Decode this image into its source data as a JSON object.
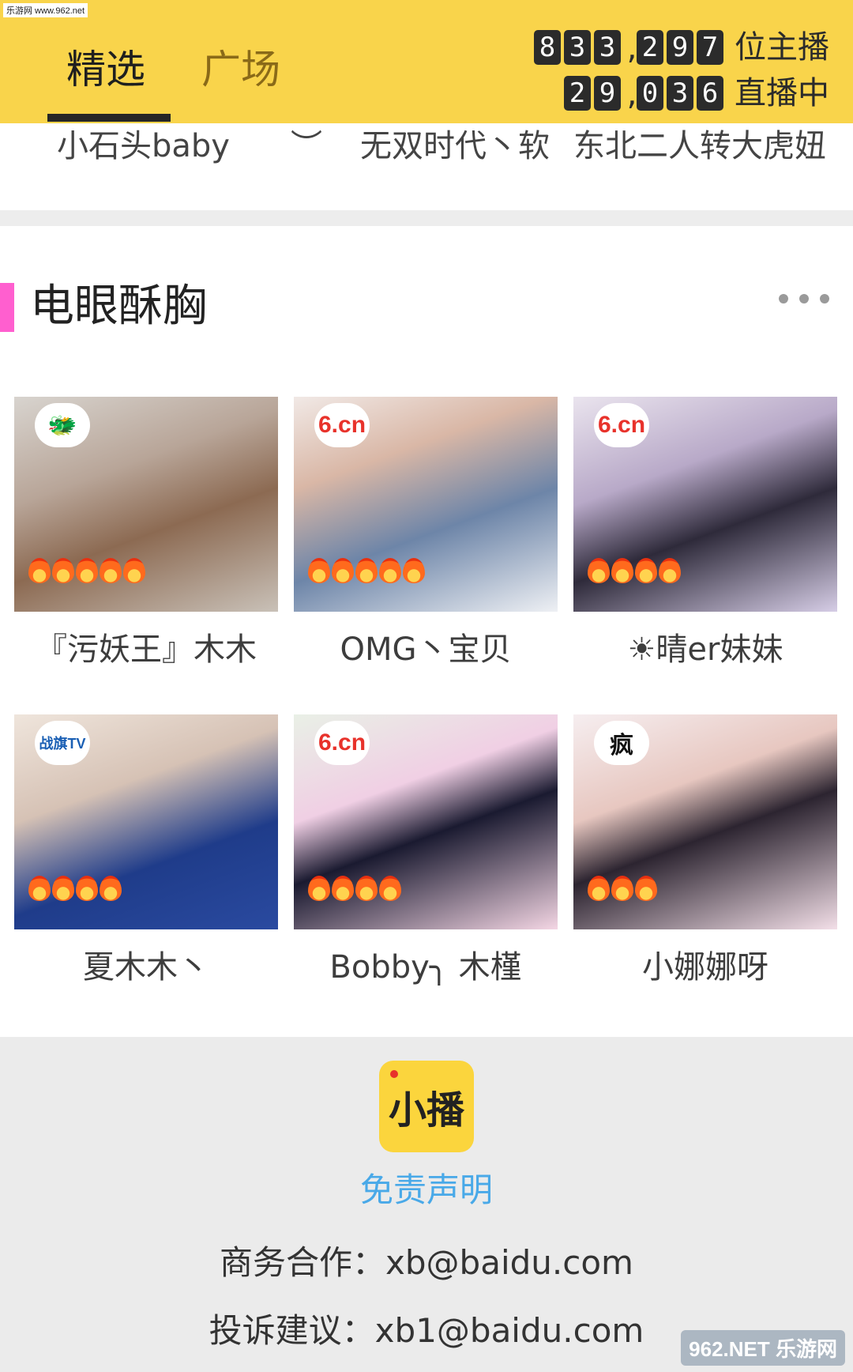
{
  "watermark_top": "乐游网 www.962.net",
  "tabs": [
    {
      "label": "精选",
      "selected": true
    },
    {
      "label": "广场",
      "selected": false
    }
  ],
  "counters": {
    "streamers_digits": [
      "8",
      "3",
      "3",
      ",",
      "2",
      "9",
      "7"
    ],
    "streamers_label": "位主播",
    "live_digits": [
      "2",
      "9",
      ",",
      "0",
      "3",
      "6"
    ],
    "live_label": "直播中"
  },
  "scroll_names": [
    "小石头baby",
    "︶",
    "无双时代丶软",
    "东北二人转大虎妞"
  ],
  "section": {
    "title": "电眼酥胸",
    "more_icon": "more-dots-icon",
    "accent": "#ff5fcf"
  },
  "streamers": [
    {
      "name": "『污妖王』木木",
      "platform_logo": "dragon-logo",
      "heat": 5
    },
    {
      "name": "OMG丶宝贝",
      "platform_logo": "6.cn",
      "heat": 5
    },
    {
      "name": "☀晴er妹妹",
      "platform_logo": "6.cn",
      "heat": 4
    },
    {
      "name": "夏木木丶",
      "platform_logo": "战旗TV",
      "heat": 4
    },
    {
      "name": "Bobby╮ 木槿",
      "platform_logo": "6.cn",
      "heat": 4
    },
    {
      "name": "小娜娜呀",
      "platform_logo": "疯",
      "heat": 3
    }
  ],
  "footer": {
    "app_name": "小播",
    "disclaimer": "免责声明",
    "business": "商务合作：xb@baidu.com",
    "complaint": "投诉建议：xb1@baidu.com"
  },
  "watermark_bottom": "962.NET 乐游网",
  "colors": {
    "topbar": "#f9d44b",
    "footer": "#ebebeb",
    "link": "#49a9e8"
  }
}
